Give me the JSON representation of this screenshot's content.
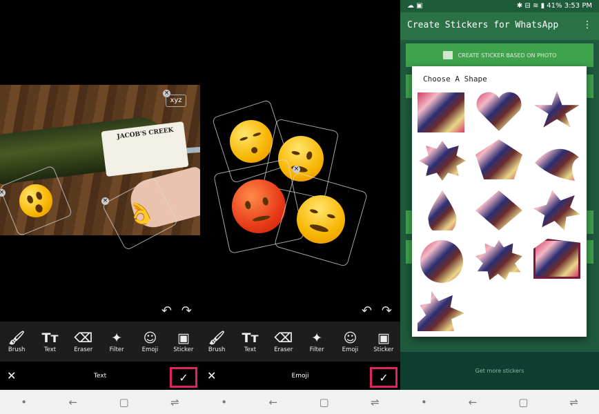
{
  "editor1": {
    "photo_label": "JACOB'S CREEK",
    "text_sticker": "xyz",
    "undo_icon": "undo-icon",
    "redo_icon": "redo-icon",
    "tools": [
      {
        "label": "Brush",
        "icon": "brush-icon"
      },
      {
        "label": "Text",
        "icon": "text-icon"
      },
      {
        "label": "Eraser",
        "icon": "eraser-icon"
      },
      {
        "label": "Filter",
        "icon": "filter-icon"
      },
      {
        "label": "Emoji",
        "icon": "emoji-icon"
      },
      {
        "label": "Sticker",
        "icon": "sticker-icon"
      }
    ],
    "action_title": "Text"
  },
  "editor2": {
    "tools": [
      {
        "label": "Brush",
        "icon": "brush-icon"
      },
      {
        "label": "Text",
        "icon": "text-icon"
      },
      {
        "label": "Eraser",
        "icon": "eraser-icon"
      },
      {
        "label": "Filter",
        "icon": "filter-icon"
      },
      {
        "label": "Emoji",
        "icon": "emoji-icon"
      },
      {
        "label": "Sticker",
        "icon": "sticker-icon"
      }
    ],
    "action_title": "Emoji"
  },
  "app": {
    "status_time": "3:53 PM",
    "status_battery": "41%",
    "title": "Create Stickers for WhatsApp",
    "create_button": "CREATE STICKER BASED ON PHOTO",
    "get_more": "Get more stickers",
    "dialog_title": "Choose A Shape",
    "shapes": [
      "square",
      "heart",
      "star",
      "burst",
      "pentagon",
      "leaf",
      "drop",
      "diamond",
      "splat",
      "circle",
      "star-burst",
      "frame",
      "triangle-star"
    ]
  },
  "colors": {
    "highlight": "#e0245e",
    "app_green": "#2b7146",
    "button_green": "#3fa34d"
  }
}
